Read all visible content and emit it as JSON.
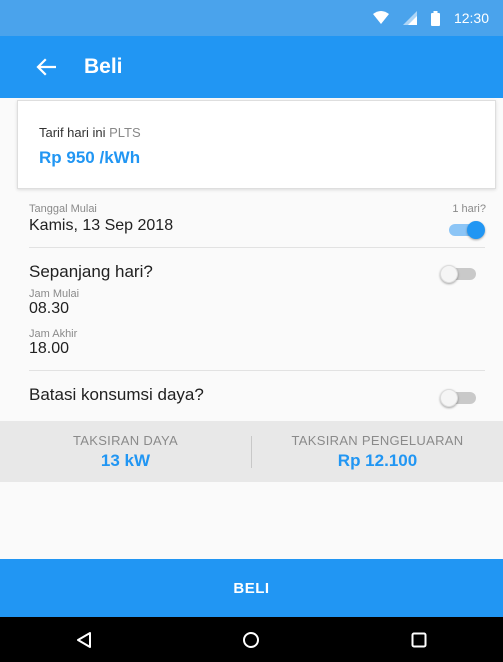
{
  "status_bar": {
    "time": "12:30"
  },
  "app_bar": {
    "title": "Beli"
  },
  "tariff_card": {
    "label": "Tarif hari ini",
    "source": "PLTS",
    "price": "Rp 950 /kWh"
  },
  "start_date": {
    "label": "Tanggal Mulai",
    "value": "Kamis, 13 Sep 2018",
    "one_day_label": "1 hari?",
    "one_day_on": true
  },
  "all_day": {
    "label": "Sepanjang hari?",
    "on": false
  },
  "start_time": {
    "label": "Jam Mulai",
    "value": "08.30"
  },
  "end_time": {
    "label": "Jam Akhir",
    "value": "18.00"
  },
  "limit_power": {
    "label": "Batasi konsumsi daya?",
    "on": false
  },
  "summary": {
    "power_label": "TAKSIRAN DAYA",
    "power_value": "13 kW",
    "cost_label": "TAKSIRAN PENGELUARAN",
    "cost_value": "Rp 12.100"
  },
  "buy_button": {
    "label": "BELI"
  },
  "icons": {
    "back": "arrow-left-icon",
    "wifi": "wifi-icon",
    "signal": "signal-icon",
    "battery": "battery-icon",
    "nav_back": "triangle-back-icon",
    "nav_home": "circle-home-icon",
    "nav_recent": "square-recent-icon"
  },
  "colors": {
    "primary": "#2196f3",
    "status_bar": "#4aa3ec",
    "summary_bg": "#e8e8e8"
  }
}
